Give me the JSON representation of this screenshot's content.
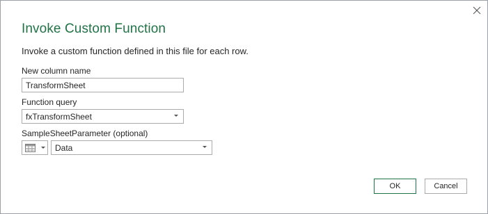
{
  "dialog": {
    "title": "Invoke Custom Function",
    "description": "Invoke a custom function defined in this file for each row.",
    "close_icon": "close-icon",
    "accent_color": "#217346"
  },
  "fields": {
    "new_column": {
      "label": "New column name",
      "value": "TransformSheet"
    },
    "function_query": {
      "label": "Function query",
      "selected": "fxTransformSheet"
    },
    "parameter": {
      "label": "SampleSheetParameter (optional)",
      "type_icon": "table-icon",
      "selected": "Data"
    }
  },
  "buttons": {
    "ok": "OK",
    "cancel": "Cancel"
  }
}
